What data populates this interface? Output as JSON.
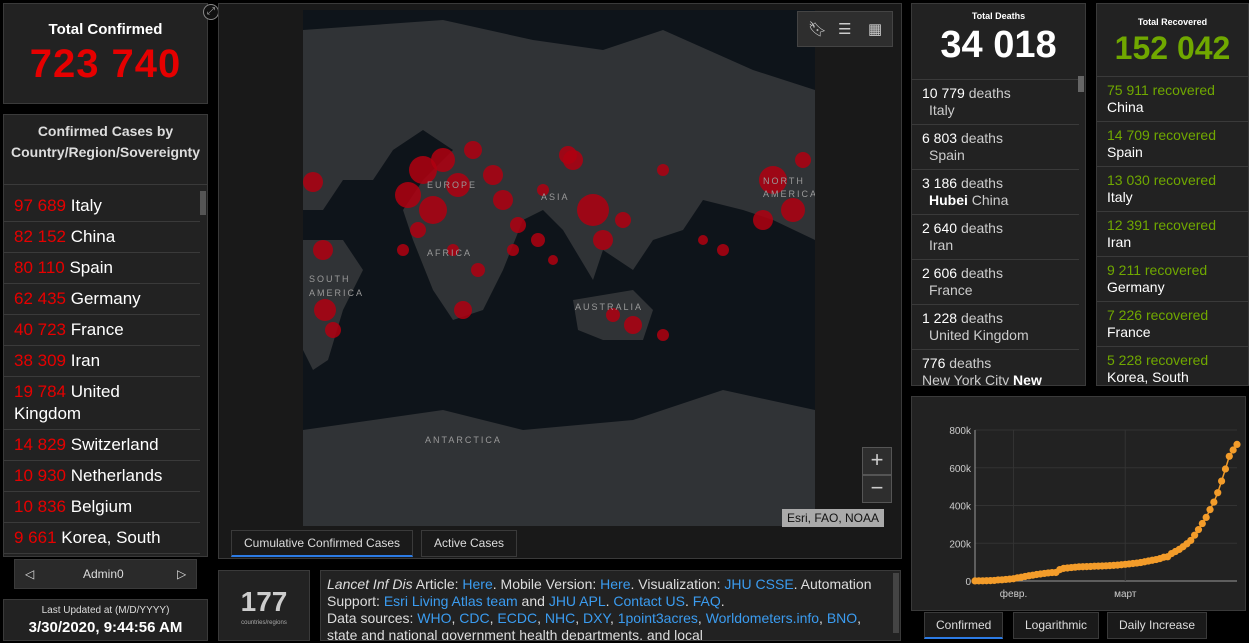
{
  "totals": {
    "confirmed_title": "Total Confirmed",
    "confirmed_value": "723 740",
    "deaths_title": "Total Deaths",
    "deaths_value": "34 018",
    "recovered_title": "Total Recovered",
    "recovered_value": "152 042"
  },
  "country_list": {
    "title": "Confirmed Cases by Country/Region/Sovereignty",
    "items": [
      {
        "count": "97 689",
        "name": "Italy"
      },
      {
        "count": "82 152",
        "name": "China"
      },
      {
        "count": "80 110",
        "name": "Spain"
      },
      {
        "count": "62 435",
        "name": "Germany"
      },
      {
        "count": "40 723",
        "name": "France"
      },
      {
        "count": "38 309",
        "name": "Iran"
      },
      {
        "count": "19 784",
        "name": "United Kingdom"
      },
      {
        "count": "14 829",
        "name": "Switzerland"
      },
      {
        "count": "10 930",
        "name": "Netherlands"
      },
      {
        "count": "10 836",
        "name": "Belgium"
      },
      {
        "count": "9 661",
        "name": "Korea, South"
      }
    ]
  },
  "admin_nav": {
    "label": "Admin0",
    "prev_icon": "triangle-left-icon",
    "next_icon": "triangle-right-icon"
  },
  "last_updated": {
    "title": "Last Updated at (M/D/YYYY)",
    "value": "3/30/2020, 9:44:56 AM"
  },
  "map": {
    "labels": [
      "EUROPE",
      "ASIA",
      "NORTH AMERICA",
      "AFRICA",
      "SOUTH AMERICA",
      "AUSTRALIA",
      "ANTARCTICA"
    ],
    "attribution": "Esri, FAO, NOAA",
    "zoom_in": "+",
    "zoom_out": "−",
    "tools": [
      "bookmark-icon",
      "list-icon",
      "qr-grid-icon"
    ],
    "tabs": [
      "Cumulative Confirmed Cases",
      "Active Cases"
    ],
    "bubble_color": "#b00010"
  },
  "regions": {
    "count": "177",
    "label": "countries/regions"
  },
  "sources": {
    "lancet": "Lancet Inf Dis",
    "article_text": " Article: ",
    "here1": "Here",
    "mobile_text": ". Mobile Version: ",
    "here2": "Here",
    "viz_text": ". Visualization: ",
    "jhu_csse": "JHU CSSE",
    "automation_text": ". Automation Support: ",
    "esri": "Esri Living Atlas team",
    "and_text": " and ",
    "jhu_apl": "JHU APL",
    "dot": ". ",
    "contact": "Contact US",
    "faq": "FAQ",
    "data_sources": "Data sources: ",
    "s1": "WHO",
    "s2": "CDC",
    "s3": "ECDC",
    "s4": "NHC",
    "s5": "DXY",
    "s6": "1point3acres",
    "s7": "Worldometers.info",
    "s8": "BNO",
    "tail": ", state and national government health departments, and local"
  },
  "deaths": [
    {
      "count": "10 779",
      "unit": "deaths",
      "place_bold": "",
      "place": "Italy"
    },
    {
      "count": "6 803",
      "unit": "deaths",
      "place_bold": "",
      "place": "Spain"
    },
    {
      "count": "3 186",
      "unit": "deaths",
      "place_bold": "Hubei",
      "place": "China"
    },
    {
      "count": "2 640",
      "unit": "deaths",
      "place_bold": "",
      "place": "Iran"
    },
    {
      "count": "2 606",
      "unit": "deaths",
      "place_bold": "",
      "place": "France"
    },
    {
      "count": "1 228",
      "unit": "deaths",
      "place_bold": "",
      "place": "United Kingdom"
    },
    {
      "count": "776",
      "unit": "deaths",
      "place_bold": "New",
      "place": "New York City"
    }
  ],
  "recovered": [
    {
      "count": "75 911",
      "unit": "recovered",
      "place": "China"
    },
    {
      "count": "14 709",
      "unit": "recovered",
      "place": "Spain"
    },
    {
      "count": "13 030",
      "unit": "recovered",
      "place": "Italy"
    },
    {
      "count": "12 391",
      "unit": "recovered",
      "place": "Iran"
    },
    {
      "count": "9 211",
      "unit": "recovered",
      "place": "Germany"
    },
    {
      "count": "7 226",
      "unit": "recovered",
      "place": "France"
    },
    {
      "count": "5 228",
      "unit": "recovered",
      "place": "Korea, South"
    }
  ],
  "chart_tabs": [
    "Confirmed",
    "Logarithmic",
    "Daily Increase"
  ],
  "colors": {
    "confirmed": "#e60000",
    "recovered": "#70a800",
    "chart": "#f39c2a",
    "link": "#3b9cf0"
  },
  "chart_data": {
    "type": "scatter",
    "title": "",
    "xlabel": "",
    "ylabel": "",
    "yticks": [
      "0",
      "200k",
      "400k",
      "600k",
      "800k"
    ],
    "ylim": [
      0,
      800000
    ],
    "xticks": [
      {
        "label": "февр.",
        "day": 10
      },
      {
        "label": "март",
        "day": 39
      }
    ],
    "x_days": [
      0,
      1,
      2,
      3,
      4,
      5,
      6,
      7,
      8,
      9,
      10,
      11,
      12,
      13,
      14,
      15,
      16,
      17,
      18,
      19,
      20,
      21,
      22,
      23,
      24,
      25,
      26,
      27,
      28,
      29,
      30,
      31,
      32,
      33,
      34,
      35,
      36,
      37,
      38,
      39,
      40,
      41,
      42,
      43,
      44,
      45,
      46,
      47,
      48,
      49,
      50,
      51,
      52,
      53,
      54,
      55,
      56,
      57,
      58,
      59,
      60,
      61,
      62,
      63,
      64,
      65,
      66,
      67,
      68
    ],
    "values": [
      555,
      654,
      941,
      1434,
      2118,
      2927,
      5578,
      6166,
      8234,
      9927,
      12038,
      16787,
      19881,
      23892,
      27635,
      30794,
      34391,
      37120,
      40150,
      42762,
      44802,
      45221,
      60368,
      66885,
      69030,
      71224,
      73258,
      75136,
      75639,
      76197,
      76819,
      78572,
      78958,
      79561,
      80406,
      81388,
      82746,
      84112,
      86011,
      88369,
      90306,
      92840,
      95120,
      97886,
      101801,
      105847,
      109821,
      113590,
      118620,
      125875,
      128343,
      145193,
      156097,
      167449,
      181546,
      197168,
      214915,
      242713,
      272167,
      304528,
      336953,
      378235,
      418045,
      467653,
      529591,
      593291,
      660706,
      694000,
      723740
    ],
    "grid": true,
    "legend": "none"
  }
}
